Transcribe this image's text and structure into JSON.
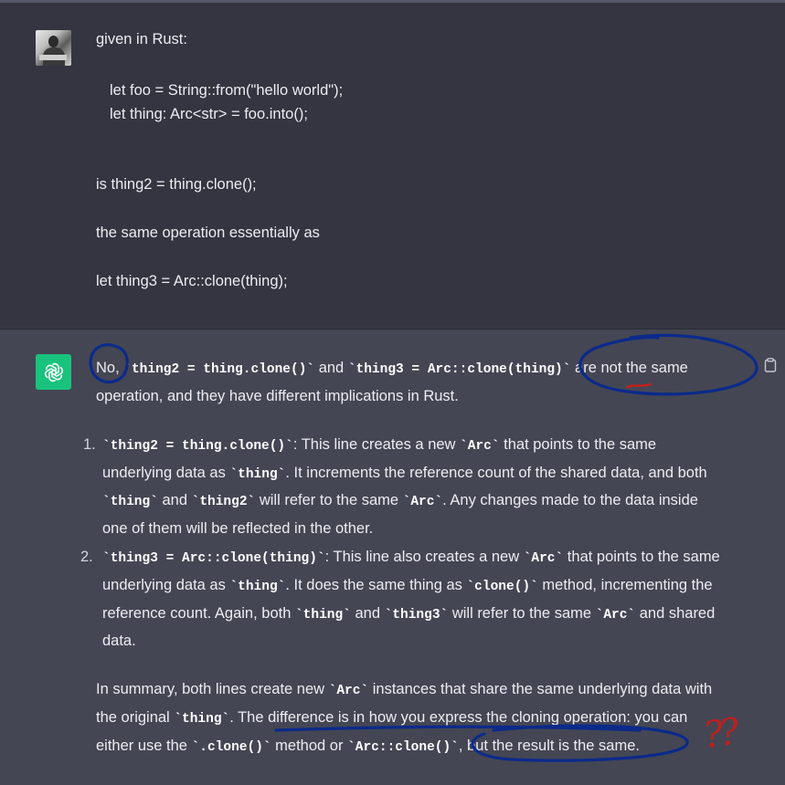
{
  "user_message": {
    "intro": "given in Rust:",
    "code_line1": "let foo = String::from(\"hello world\");",
    "code_line2": "let thing: Arc<str> = foo.into();",
    "question_line1": "is thing2 = thing.clone();",
    "question_line2": "the same operation essentially as",
    "question_line3": "let thing3 = Arc::clone(thing);"
  },
  "assistant_message": {
    "p1": {
      "a": "No, ",
      "code1": "`thing2 = thing.clone()`",
      "b": " and ",
      "code2": "`thing3 = Arc::clone(thing)`",
      "c": " are not the same",
      "line2": "operation, and they have different implications in Rust."
    },
    "item1": {
      "num": "1.",
      "code": "`thing2 = thing.clone()`",
      "t1": ": This line creates a new ",
      "arc": "`Arc`",
      "t2": " that points to the same",
      "l2a": "underlying data as ",
      "l2code": "`thing`",
      "l2b": ". It increments the reference count of the shared data, and both",
      "l3code1": "`thing`",
      "l3a": " and ",
      "l3code2": "`thing2`",
      "l3b": " will refer to the same ",
      "l3code3": "`Arc`",
      "l3c": ". Any changes made to the data inside",
      "l4": "one of them will be reflected in the other."
    },
    "item2": {
      "num": "2.",
      "code": "`thing3 = Arc::clone(thing)`",
      "t1": ": This line also creates a new ",
      "arc": "`Arc`",
      "t2": " that points to the same",
      "l2a": "underlying data as ",
      "l2code": "`thing`",
      "l2b": ". It does the same thing as ",
      "l2code2": "`clone()`",
      "l2c": " method, incrementing the",
      "l3a": "reference count. Again, both ",
      "l3code1": "`thing`",
      "l3b": " and ",
      "l3code2": "`thing3`",
      "l3c": " will refer to the same ",
      "l3code3": "`Arc`",
      "l3d": " and shared",
      "l4": "data."
    },
    "summary": {
      "l1a": "In summary, both lines create new ",
      "l1code": "`Arc`",
      "l1b": " instances that share the same underlying data with",
      "l2a": "the original ",
      "l2code": "`thing`",
      "l2b": ". The difference is in how you express the cloning operation: you can",
      "l3a": "either use the ",
      "l3code1": "`.clone()`",
      "l3b": " method or ",
      "l3code2": "`Arc::clone()`",
      "l3c": ", but the result is the same."
    }
  },
  "annotation": {
    "marks": "??",
    "ink_blue": "#0b2a8a",
    "ink_red": "#c0201a"
  },
  "icons": {
    "user_avatar": "user-photo-avatar",
    "assistant_avatar": "openai-logo-icon",
    "copy": "clipboard-icon"
  },
  "colors": {
    "background": "#343541",
    "assistant_background": "#444654",
    "brand": "#19c37d"
  }
}
